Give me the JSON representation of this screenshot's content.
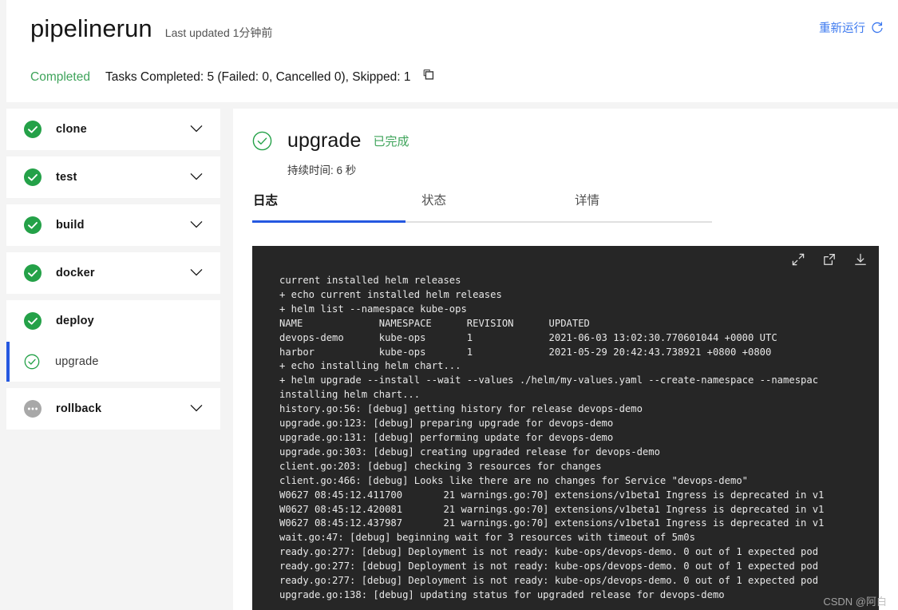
{
  "header": {
    "title": "pipelinerun",
    "last_updated": "Last updated 1分钟前",
    "rerun_label": "重新运行",
    "rerun_icon": "refresh-icon",
    "status_word": "Completed",
    "status_detail": "Tasks Completed: 5 (Failed: 0, Cancelled 0), Skipped: 1",
    "copy_icon": "copy-icon",
    "status_color": "#3fa45b",
    "accent_color": "#2558e0"
  },
  "sidebar": {
    "tasks": [
      {
        "label": "clone",
        "status": "succeeded",
        "icon": "check-filled-icon",
        "chevron": "chevron-down-icon",
        "expanded": false
      },
      {
        "label": "test",
        "status": "succeeded",
        "icon": "check-filled-icon",
        "chevron": "chevron-down-icon",
        "expanded": false
      },
      {
        "label": "build",
        "status": "succeeded",
        "icon": "check-filled-icon",
        "chevron": "chevron-down-icon",
        "expanded": false
      },
      {
        "label": "docker",
        "status": "succeeded",
        "icon": "check-filled-icon",
        "chevron": "chevron-down-icon",
        "expanded": false
      },
      {
        "label": "deploy",
        "status": "succeeded",
        "icon": "check-filled-icon",
        "chevron": "",
        "expanded": true
      },
      {
        "label": "rollback",
        "status": "skipped",
        "icon": "dots-circle-icon",
        "chevron": "chevron-down-icon",
        "expanded": false
      }
    ],
    "steps": [
      {
        "label": "upgrade",
        "status": "succeeded",
        "icon": "check-outline-icon",
        "selected": true
      }
    ]
  },
  "main": {
    "step_name": "upgrade",
    "step_state": "已完成",
    "step_icon": "check-outline-icon",
    "duration": "持续时间: 6 秒",
    "tabs": [
      {
        "label": "日志",
        "active": true
      },
      {
        "label": "状态",
        "active": false
      },
      {
        "label": "详情",
        "active": false
      }
    ],
    "log_tools": [
      {
        "icon": "expand-icon"
      },
      {
        "icon": "popout-icon"
      },
      {
        "icon": "download-icon"
      }
    ],
    "log_lines": "current installed helm releases\n+ echo current installed helm releases\n+ helm list --namespace kube-ops\nNAME             NAMESPACE      REVISION      UPDATED\ndevops-demo      kube-ops       1             2021-06-03 13:02:30.770601044 +0000 UTC\nharbor           kube-ops       1             2021-05-29 20:42:43.738921 +0800 +0800\n+ echo installing helm chart...\n+ helm upgrade --install --wait --values ./helm/my-values.yaml --create-namespace --namespac\ninstalling helm chart...\nhistory.go:56: [debug] getting history for release devops-demo\nupgrade.go:123: [debug] preparing upgrade for devops-demo\nupgrade.go:131: [debug] performing update for devops-demo\nupgrade.go:303: [debug] creating upgraded release for devops-demo\nclient.go:203: [debug] checking 3 resources for changes\nclient.go:466: [debug] Looks like there are no changes for Service \"devops-demo\"\nW0627 08:45:12.411700       21 warnings.go:70] extensions/v1beta1 Ingress is deprecated in v1\nW0627 08:45:12.420081       21 warnings.go:70] extensions/v1beta1 Ingress is deprecated in v1\nW0627 08:45:12.437987       21 warnings.go:70] extensions/v1beta1 Ingress is deprecated in v1\nwait.go:47: [debug] beginning wait for 3 resources with timeout of 5m0s\nready.go:277: [debug] Deployment is not ready: kube-ops/devops-demo. 0 out of 1 expected pod\nready.go:277: [debug] Deployment is not ready: kube-ops/devops-demo. 0 out of 1 expected pod\nready.go:277: [debug] Deployment is not ready: kube-ops/devops-demo. 0 out of 1 expected pod\nupgrade.go:138: [debug] updating status for upgraded release for devops-demo"
  },
  "watermark": "CSDN @阿白"
}
